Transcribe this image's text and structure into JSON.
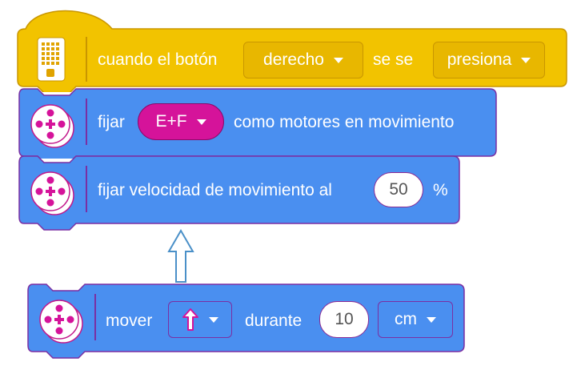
{
  "colors": {
    "event_block": "#f2c300",
    "motion_block": "#4a8ff0",
    "block_outline": "#8a2a94",
    "motor_pill": "#d5139a",
    "arrow_outline": "#4a90c8"
  },
  "event_block": {
    "icon": "hub-button-icon",
    "label": "cuando el botón",
    "button_dropdown": "derecho",
    "connector": "se se",
    "action_dropdown": "presiona"
  },
  "set_motors_block": {
    "icon": "motor-pair-icon",
    "label": "fijar",
    "motors_dropdown": "E+F",
    "suffix": "como motores en movimiento"
  },
  "set_speed_block": {
    "icon": "motor-pair-icon",
    "label": "fijar velocidad de movimiento al",
    "speed_value": "50",
    "unit": "%"
  },
  "drag_hint": {
    "icon": "arrow-up-outline-icon"
  },
  "move_block": {
    "icon": "motor-pair-icon",
    "label": "mover",
    "direction_icon": "arrow-up-icon",
    "for_label": "durante",
    "distance_value": "10",
    "unit_dropdown": "cm"
  }
}
